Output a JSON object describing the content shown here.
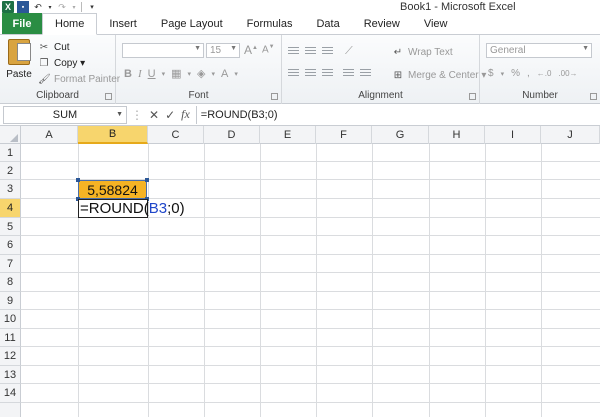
{
  "window": {
    "title": "Book1  -  Microsoft Excel",
    "quick_access": [
      "excel-logo-icon",
      "save-icon",
      "undo-icon",
      "redo-icon",
      "customize-icon"
    ]
  },
  "tabs": [
    "File",
    "Home",
    "Insert",
    "Page Layout",
    "Formulas",
    "Data",
    "Review",
    "View"
  ],
  "active_tab": "Home",
  "ribbon": {
    "clipboard": {
      "label": "Clipboard",
      "paste": "Paste",
      "cut": "Cut",
      "copy": "Copy ▾",
      "format_painter": "Format Painter"
    },
    "font": {
      "label": "Font",
      "size": "15"
    },
    "alignment": {
      "label": "Alignment",
      "wrap_text": "Wrap Text",
      "merge_center": "Merge & Center ▾"
    },
    "number": {
      "label": "Number",
      "format": "General"
    }
  },
  "formula_bar": {
    "name_box": "SUM",
    "formula": "=ROUND(B3;0)"
  },
  "grid": {
    "columns": [
      "A",
      "B",
      "C",
      "D",
      "E",
      "F",
      "G",
      "H",
      "I",
      "J"
    ],
    "rows": [
      "1",
      "2",
      "3",
      "4",
      "5",
      "6",
      "7",
      "8",
      "9",
      "10",
      "11",
      "12",
      "13",
      "14"
    ],
    "selected_column": "B",
    "selected_row": "4",
    "cells": {
      "B3": "5,58824",
      "B4_fn": "=ROUND(",
      "B4_ref": "B3",
      "B4_rest": ";0)"
    },
    "highlight_color": "#f5b324",
    "reference_color": "#1f46c9"
  }
}
